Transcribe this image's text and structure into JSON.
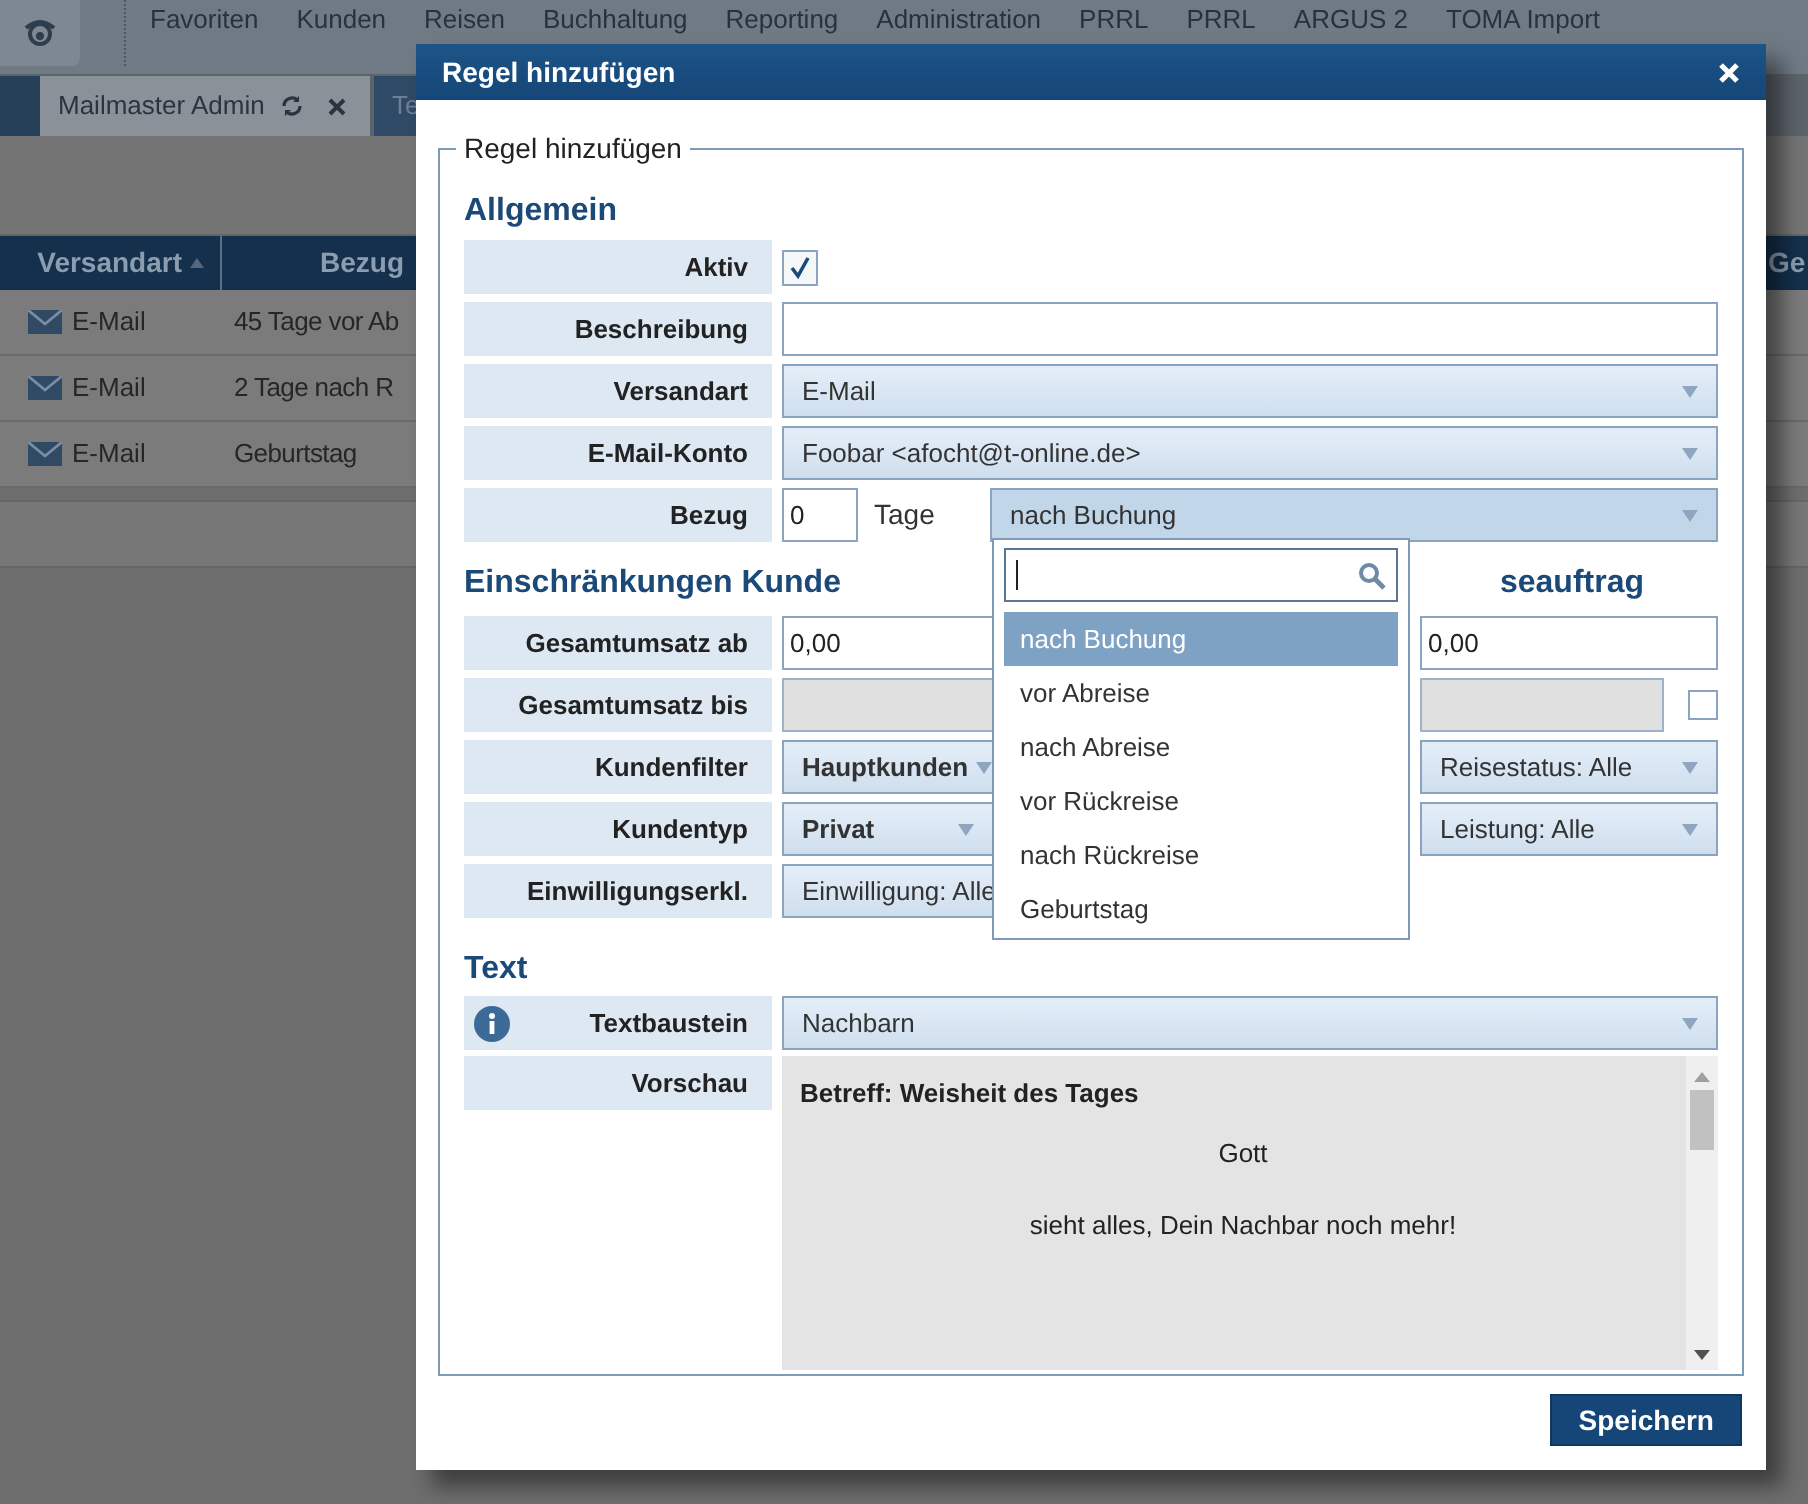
{
  "nav": {
    "items": [
      "Favoriten",
      "Kunden",
      "Reisen",
      "Buchhaltung",
      "Reporting",
      "Administration",
      "PRRL",
      "PRRL",
      "ARGUS 2",
      "TOMA Import"
    ]
  },
  "tabs": [
    {
      "label": "Mailmaster Admin",
      "selected": true
    },
    {
      "label": "Te",
      "selected": false
    }
  ],
  "table": {
    "columns": [
      "Versandart",
      "Bezug",
      "Ge"
    ],
    "rows": [
      [
        "E-Mail",
        "45 Tage vor Ab"
      ],
      [
        "E-Mail",
        "2 Tage nach R"
      ],
      [
        "E-Mail",
        "Geburtstag"
      ]
    ]
  },
  "dialog": {
    "title": "Regel hinzufügen",
    "legend": "Regel hinzufügen",
    "general": {
      "heading": "Allgemein",
      "aktiv_label": "Aktiv",
      "aktiv_checked": true,
      "beschreibung_label": "Beschreibung",
      "versandart_label": "Versandart",
      "versandart_value": "E-Mail",
      "konto_label": "E-Mail-Konto",
      "konto_value": "Foobar <afocht@t-online.de>",
      "bezug_label": "Bezug",
      "bezug_days": "0",
      "bezug_unit": "Tage",
      "bezug_value": "nach Buchung"
    },
    "dropdown": {
      "options": [
        {
          "label": "nach Buchung",
          "selected": true
        },
        {
          "label": "vor Abreise",
          "selected": false
        },
        {
          "label": "nach Abreise",
          "selected": false
        },
        {
          "label": "vor Rückreise",
          "selected": false
        },
        {
          "label": "nach Rückreise",
          "selected": false
        },
        {
          "label": "Geburtstag",
          "selected": false
        }
      ]
    },
    "customer": {
      "heading": "Einschränkungen Kunde",
      "rows": [
        {
          "label": "Gesamtumsatz ab",
          "kind": "input",
          "value": "0,00"
        },
        {
          "label": "Gesamtumsatz bis",
          "kind": "disabled"
        },
        {
          "label": "Kundenfilter",
          "kind": "bold-select",
          "value": "Hauptkunden"
        },
        {
          "label": "Kundentyp",
          "kind": "bold-select",
          "value": "Privat"
        },
        {
          "label": "Einwilligungserkl.",
          "kind": "select",
          "value": "Einwilligung: Alle"
        }
      ]
    },
    "order": {
      "heading": "seauftrag",
      "rows": [
        {
          "kind": "input",
          "value": "0,00"
        },
        {
          "kind": "disabled-check",
          "checked": false
        },
        {
          "kind": "select",
          "value": "Reisestatus: Alle"
        },
        {
          "kind": "select",
          "value": "Leistung: Alle"
        }
      ]
    },
    "text": {
      "heading": "Text",
      "baustein_label": "Textbaustein",
      "baustein_value": "Nachbarn",
      "preview_label": "Vorschau",
      "subject": "Betreff: Weisheit des Tages",
      "lines": [
        "Gott",
        "sieht alles, Dein Nachbar noch mehr!"
      ]
    },
    "save": "Speichern"
  }
}
